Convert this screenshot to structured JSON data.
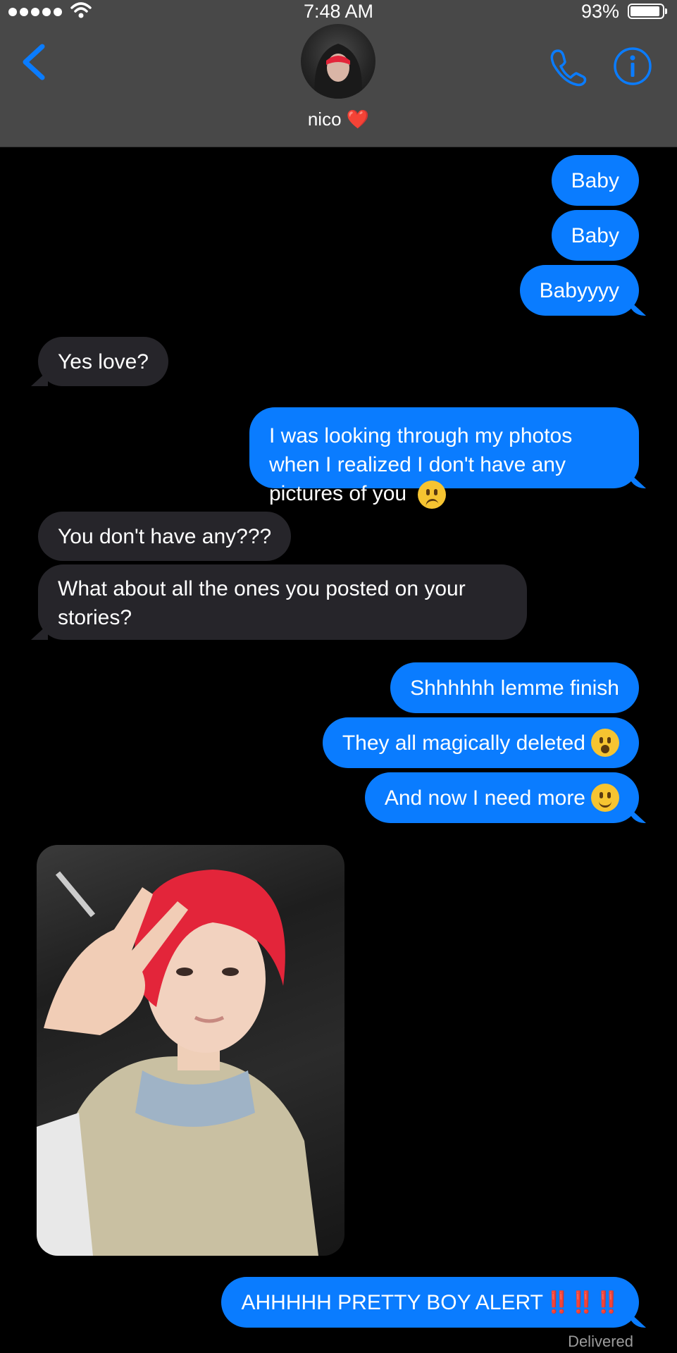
{
  "status_bar": {
    "time": "7:48 AM",
    "battery": "93%"
  },
  "header": {
    "contact_name": "nico",
    "heart": "❤️"
  },
  "messages": [
    {
      "from": "me",
      "text": "Baby"
    },
    {
      "from": "me",
      "text": "Baby"
    },
    {
      "from": "me",
      "text": "Babyyyy"
    },
    {
      "from": "them",
      "text": "Yes love?"
    },
    {
      "from": "me",
      "text": "I was looking through my photos when I realized I don't have any pictures of you",
      "emoji": "confused-face"
    },
    {
      "from": "them",
      "text": "You don't have any???"
    },
    {
      "from": "them",
      "text": "What about all the ones you posted on your stories?"
    },
    {
      "from": "me",
      "text": "Shhhhhh lemme finish"
    },
    {
      "from": "me",
      "text": "They all magically deleted",
      "emoji": "screaming-face"
    },
    {
      "from": "me",
      "text": "And now I need more",
      "emoji": "slightly-smiling-face"
    },
    {
      "from": "them",
      "type": "photo"
    },
    {
      "from": "me",
      "text": "AHHHHH PRETTY BOY ALERT",
      "suffix": "‼️‼️‼️"
    }
  ],
  "delivery_status": "Delivered",
  "colors": {
    "outgoing_bubble": "#0a7cff",
    "incoming_bubble": "#26252a",
    "header_bg": "#484848",
    "accent": "#0a7cff"
  }
}
